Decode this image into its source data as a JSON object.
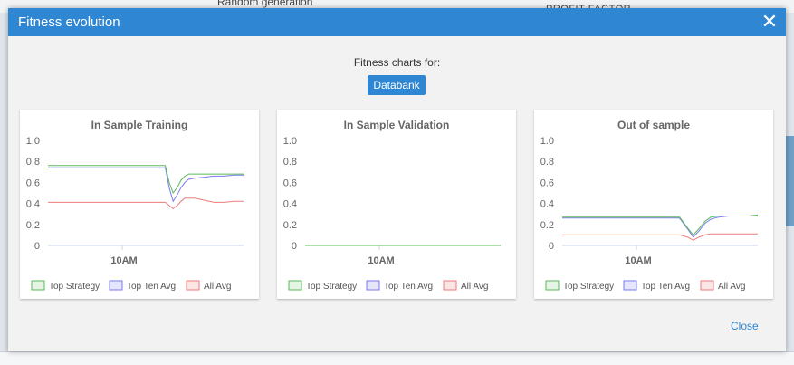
{
  "background": {
    "top_text": "Random generation",
    "top_right_text": "PROFIT FACTOR"
  },
  "dialog": {
    "title": "Fitness evolution",
    "close_icon": "close-icon",
    "subtitle": "Fitness charts for:",
    "databank_button": "Databank",
    "close_link": "Close"
  },
  "legend": {
    "top_strategy": "Top Strategy",
    "top_ten_avg": "Top Ten Avg",
    "all_avg": "All Avg"
  },
  "colors": {
    "header": "#2f86d3",
    "top_strategy": "#5cb85c",
    "top_ten_avg": "#7b7bee",
    "all_avg": "#ee7b7b"
  },
  "chart_data": [
    {
      "type": "line",
      "title": "In Sample Training",
      "x_tick_label": "10AM",
      "ylim": [
        0,
        1.0
      ],
      "yticks": [
        "1.0",
        "0.8",
        "0.6",
        "0.4",
        "0.2",
        "0"
      ],
      "x": [
        0,
        5,
        10,
        15,
        20,
        25,
        30,
        35,
        40,
        45,
        50,
        55,
        60,
        62,
        64,
        66,
        68,
        70,
        72,
        75,
        80,
        85,
        90,
        95,
        100
      ],
      "series": [
        {
          "name": "Top Strategy",
          "values": [
            0.76,
            0.76,
            0.76,
            0.76,
            0.76,
            0.76,
            0.76,
            0.76,
            0.76,
            0.76,
            0.76,
            0.76,
            0.76,
            0.6,
            0.5,
            0.55,
            0.62,
            0.66,
            0.68,
            0.68,
            0.68,
            0.68,
            0.68,
            0.68,
            0.68
          ]
        },
        {
          "name": "Top Ten Avg",
          "values": [
            0.74,
            0.74,
            0.74,
            0.74,
            0.74,
            0.74,
            0.74,
            0.74,
            0.74,
            0.74,
            0.74,
            0.74,
            0.74,
            0.55,
            0.42,
            0.48,
            0.55,
            0.6,
            0.63,
            0.64,
            0.65,
            0.66,
            0.66,
            0.67,
            0.67
          ]
        },
        {
          "name": "All Avg",
          "values": [
            0.41,
            0.41,
            0.41,
            0.41,
            0.41,
            0.41,
            0.41,
            0.41,
            0.41,
            0.41,
            0.41,
            0.41,
            0.41,
            0.38,
            0.35,
            0.38,
            0.42,
            0.45,
            0.45,
            0.45,
            0.43,
            0.41,
            0.41,
            0.42,
            0.42
          ]
        }
      ]
    },
    {
      "type": "line",
      "title": "In Sample Validation",
      "x_tick_label": "10AM",
      "ylim": [
        0,
        1.0
      ],
      "yticks": [
        "1.0",
        "0.8",
        "0.6",
        "0.4",
        "0.2",
        "0"
      ],
      "x": [
        0,
        100
      ],
      "series": [
        {
          "name": "Top Strategy",
          "values": [
            0,
            0
          ]
        },
        {
          "name": "Top Ten Avg",
          "values": [
            0,
            0
          ]
        },
        {
          "name": "All Avg",
          "values": [
            0,
            0
          ]
        }
      ]
    },
    {
      "type": "line",
      "title": "Out of sample",
      "x_tick_label": "10AM",
      "ylim": [
        0,
        1.0
      ],
      "yticks": [
        "1.0",
        "0.8",
        "0.6",
        "0.4",
        "0.2",
        "0"
      ],
      "x": [
        0,
        10,
        20,
        30,
        40,
        50,
        60,
        64,
        67,
        70,
        73,
        76,
        80,
        85,
        90,
        95,
        100
      ],
      "series": [
        {
          "name": "Top Strategy",
          "values": [
            0.27,
            0.27,
            0.27,
            0.27,
            0.27,
            0.27,
            0.27,
            0.17,
            0.1,
            0.16,
            0.23,
            0.27,
            0.28,
            0.28,
            0.28,
            0.28,
            0.29
          ]
        },
        {
          "name": "Top Ten Avg",
          "values": [
            0.26,
            0.26,
            0.26,
            0.26,
            0.26,
            0.26,
            0.26,
            0.16,
            0.08,
            0.14,
            0.21,
            0.25,
            0.27,
            0.28,
            0.28,
            0.28,
            0.28
          ]
        },
        {
          "name": "All Avg",
          "values": [
            0.1,
            0.1,
            0.1,
            0.1,
            0.1,
            0.1,
            0.1,
            0.08,
            0.05,
            0.08,
            0.1,
            0.11,
            0.11,
            0.11,
            0.11,
            0.11,
            0.11
          ]
        }
      ]
    }
  ]
}
